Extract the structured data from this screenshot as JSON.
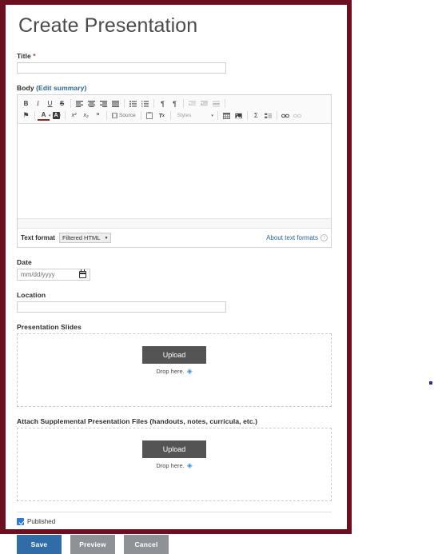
{
  "page": {
    "title": "Create Presentation",
    "border_color": "#6b0f21"
  },
  "form": {
    "title_field": {
      "label": "Title",
      "required_marker": "*",
      "value": "",
      "placeholder": ""
    },
    "body_field": {
      "label": "Body",
      "edit_summary_link": "(Edit summary)",
      "content": "",
      "toolbar_row1": [
        {
          "name": "bold-icon",
          "glyph": "B"
        },
        {
          "name": "italic-icon",
          "glyph": "I"
        },
        {
          "name": "underline-icon",
          "glyph": "U"
        },
        {
          "name": "strikethrough-icon",
          "glyph": "S"
        },
        {
          "name": "align-left-icon",
          "glyph": "▤"
        },
        {
          "name": "align-center-icon",
          "glyph": "▤"
        },
        {
          "name": "align-right-icon",
          "glyph": "▤"
        },
        {
          "name": "align-justify-icon",
          "glyph": "▤"
        },
        {
          "name": "bulleted-list-icon",
          "glyph": "☲"
        },
        {
          "name": "numbered-list-icon",
          "glyph": "☰"
        },
        {
          "name": "text-direction-rtl-icon",
          "glyph": "¶"
        },
        {
          "name": "text-direction-ltr-icon",
          "glyph": "¶"
        },
        {
          "name": "outdent-icon",
          "glyph": "◃"
        },
        {
          "name": "indent-icon",
          "glyph": "▹"
        },
        {
          "name": "horizontal-rule-icon",
          "glyph": "═"
        }
      ],
      "toolbar_row2": [
        {
          "name": "language-flag-icon",
          "glyph": "⚑"
        },
        {
          "name": "text-color-icon",
          "glyph": "A"
        },
        {
          "name": "background-color-icon",
          "glyph": "A"
        },
        {
          "name": "superscript-icon",
          "glyph": "x²"
        },
        {
          "name": "subscript-icon",
          "glyph": "x₂"
        },
        {
          "name": "blockquote-icon",
          "glyph": "❞"
        },
        {
          "name": "source-button",
          "glyph": "Source"
        },
        {
          "name": "paste-icon",
          "glyph": "▤"
        },
        {
          "name": "remove-format-icon",
          "glyph": "Tx"
        },
        {
          "name": "styles-dropdown",
          "glyph": "Styles"
        },
        {
          "name": "table-icon",
          "glyph": "▦"
        },
        {
          "name": "image-icon",
          "glyph": "▣"
        },
        {
          "name": "special-character-icon",
          "glyph": "Σ"
        },
        {
          "name": "template-icon",
          "glyph": "▨"
        },
        {
          "name": "link-icon",
          "glyph": "🔗"
        },
        {
          "name": "unlink-icon",
          "glyph": "🔗"
        }
      ],
      "text_format_label": "Text format",
      "text_format_value": "Filtered HTML",
      "about_text_formats": "About text formats"
    },
    "date_field": {
      "label": "Date",
      "placeholder": "mm/dd/yyyy",
      "value": ""
    },
    "location_field": {
      "label": "Location",
      "value": "",
      "placeholder": ""
    },
    "slides_field": {
      "label": "Presentation Slides",
      "upload_button": "Upload",
      "drop_text": "Drop here."
    },
    "supplemental_field": {
      "label": "Attach Supplemental Presentation Files (handouts, notes, curricula, etc.)",
      "upload_button": "Upload",
      "drop_text": "Drop here."
    },
    "published": {
      "label": "Published",
      "checked": true
    },
    "actions": {
      "save": "Save",
      "preview": "Preview",
      "cancel": "Cancel"
    }
  },
  "colors": {
    "save_button": "#2f6ca8",
    "secondary_button": "#8e9297",
    "upload_button": "#545454",
    "link": "#2a6496",
    "required": "#c0392b",
    "checkbox": "#2f7bd4"
  }
}
